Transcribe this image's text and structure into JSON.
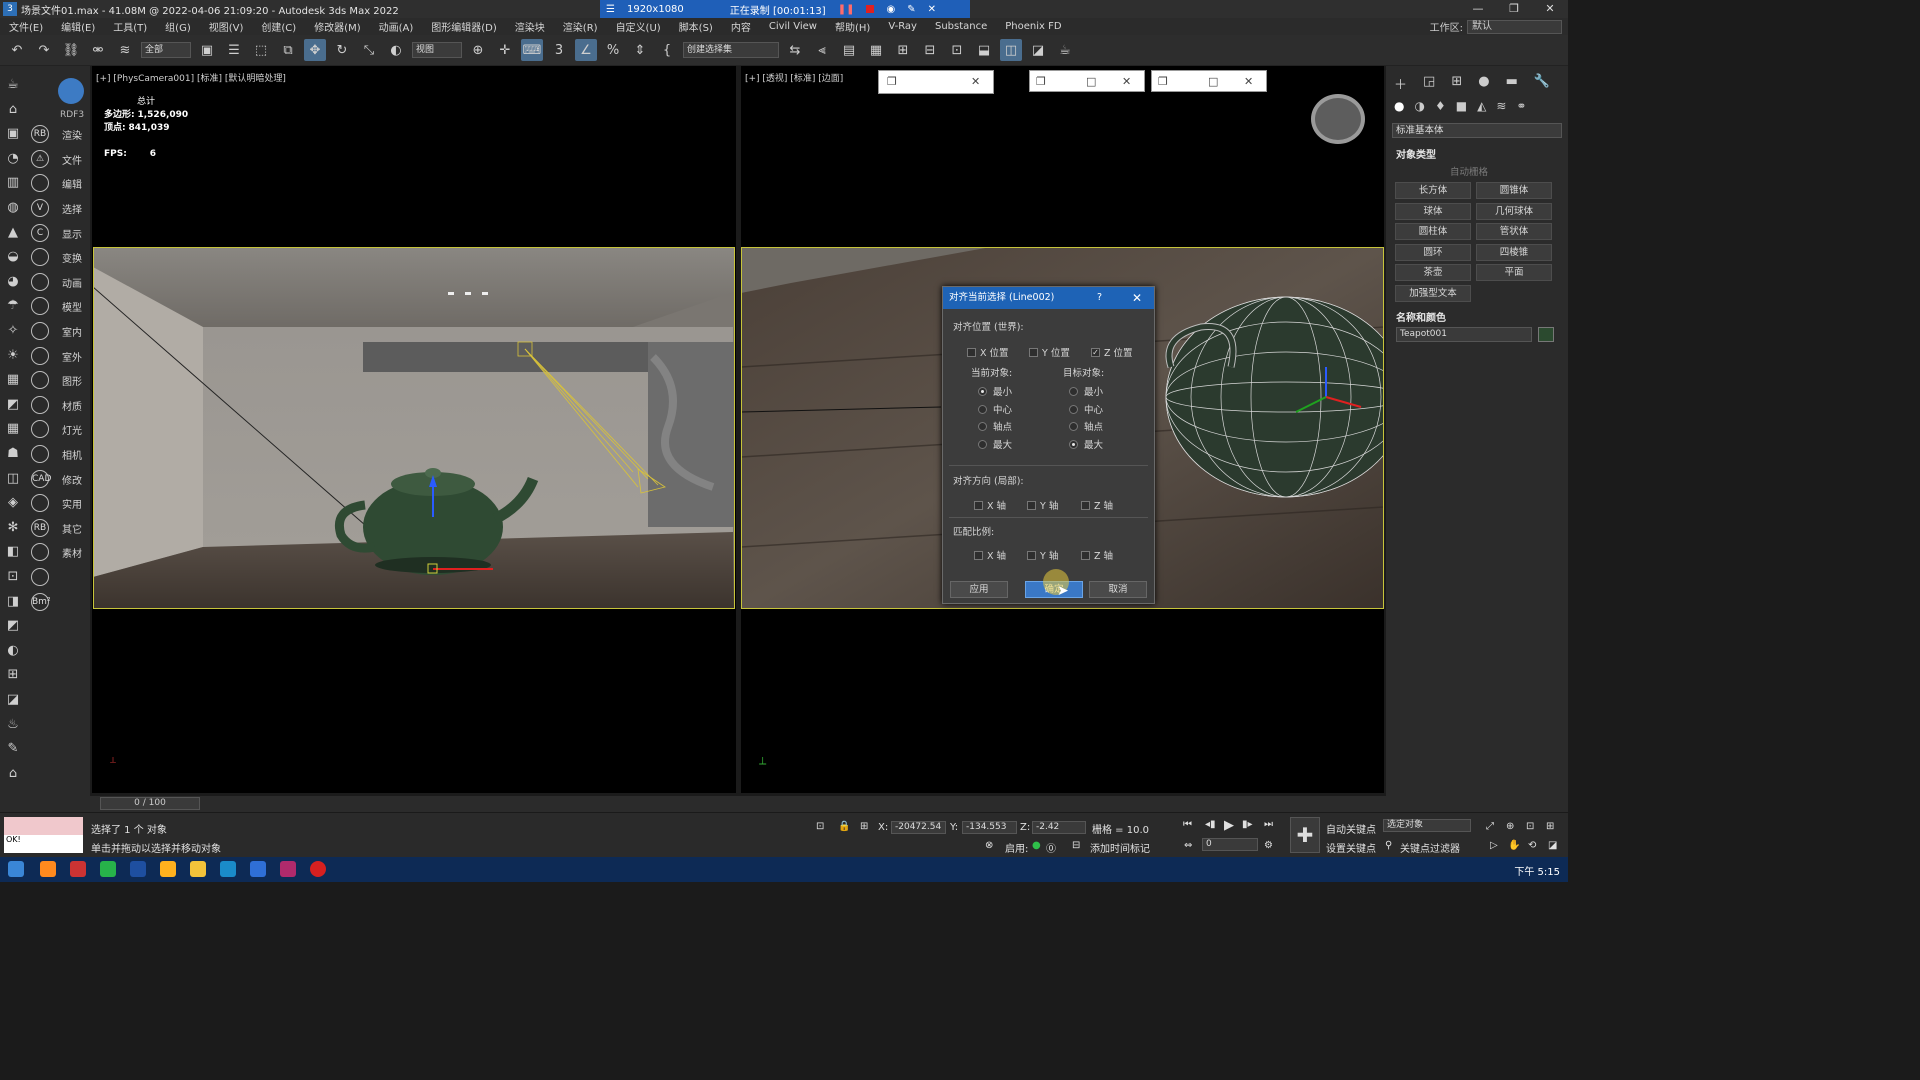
{
  "window": {
    "title": "场景文件01.max - 41.08M @ 2022-04-06 21:09:20 - Autodesk 3ds Max 2022",
    "app_icon": "3",
    "recording": {
      "resolution": "1920x1080",
      "status": "正在录制 [00:01:13]"
    }
  },
  "menu": [
    "文件(E)",
    "编辑(E)",
    "工具(T)",
    "组(G)",
    "视图(V)",
    "创建(C)",
    "修改器(M)",
    "动画(A)",
    "图形编辑器(D)",
    "渲染块",
    "渲染(R)",
    "自定义(U)",
    "脚本(S)",
    "内容",
    "Civil View",
    "帮助(H)",
    "V-Ray",
    "Substance",
    "Phoenix FD"
  ],
  "workspace": {
    "label": "工作区:",
    "value": "默认"
  },
  "toolbar": {
    "filter": "全部",
    "ref_coord": "视图",
    "selection_set": "创建选择集"
  },
  "left_labels": [
    "渲染",
    "文件",
    "编辑",
    "选择",
    "显示",
    "变换",
    "动画",
    "模型",
    "室内",
    "室外",
    "图形",
    "材质",
    "灯光",
    "相机",
    "修改",
    "实用",
    "其它",
    "素材"
  ],
  "left_col2": [
    "RB",
    "⚠",
    "",
    "V",
    "C",
    "",
    "",
    "",
    "",
    "",
    "",
    "",
    "",
    "",
    "CAD",
    "",
    "RB",
    "",
    "",
    "Bm²"
  ],
  "rdf_label": "RDF3",
  "viewport_left": {
    "label": "[+] [PhysCamera001] [标准] [默认明暗处理]",
    "stats": {
      "total": "总计",
      "poly_label": "多边形:",
      "poly": "1,526,090",
      "vert_label": "顶点:",
      "vert": "841,039",
      "fps_label": "FPS:",
      "fps": "6"
    }
  },
  "viewport_right": {
    "label": "[+] [透视] [标准] [边面]"
  },
  "dialog": {
    "title": "对齐当前选择 (Line002)",
    "help": "?",
    "close": "✕",
    "pos_section": "对齐位置 (世界):",
    "x_pos": "X 位置",
    "y_pos": "Y 位置",
    "z_pos": "Z 位置",
    "current_obj": "当前对象:",
    "target_obj": "目标对象:",
    "opt_min": "最小",
    "opt_center": "中心",
    "opt_pivot": "轴点",
    "opt_max": "最大",
    "orient_section": "对齐方向 (局部):",
    "x_axis": "X 轴",
    "y_axis": "Y 轴",
    "z_axis": "Z 轴",
    "scale_section": "匹配比例:",
    "apply": "应用",
    "ok": "确定",
    "cancel": "取消",
    "checked": {
      "x_pos": false,
      "y_pos": false,
      "z_pos": true
    },
    "current_selected": "最小",
    "target_selected": "最大"
  },
  "right_panel": {
    "dropdown": "标准基本体",
    "object_type": "对象类型",
    "auto_grid": "自动栅格",
    "primitives": [
      "长方体",
      "圆锥体",
      "球体",
      "几何球体",
      "圆柱体",
      "管状体",
      "圆环",
      "四棱锥",
      "茶壶",
      "平面",
      "加强型文本"
    ],
    "name_color": "名称和颜色",
    "object_name": "Teapot001",
    "swatch_color": "#2b4a2f"
  },
  "timeline": {
    "frame": "0 / 100"
  },
  "status": {
    "selected": "选择了 1 个 对象",
    "hint": "单击并拖动以选择并移动对象",
    "listener_text": "OK!",
    "x_label": "X:",
    "x": "-20472.54",
    "y_label": "Y:",
    "y": "-134.553",
    "z_label": "Z:",
    "z": "-2.42",
    "grid": "栅格 = 10.0",
    "enable": "启用:",
    "add_time_tag": "添加时间标记",
    "auto_key": "自动关键点",
    "set_key": "设置关键点",
    "selected_obj": "选定对象",
    "key_filter": "关键点过滤器",
    "frame_field": "0"
  },
  "taskbar": {
    "clock": "下午 5:15"
  }
}
